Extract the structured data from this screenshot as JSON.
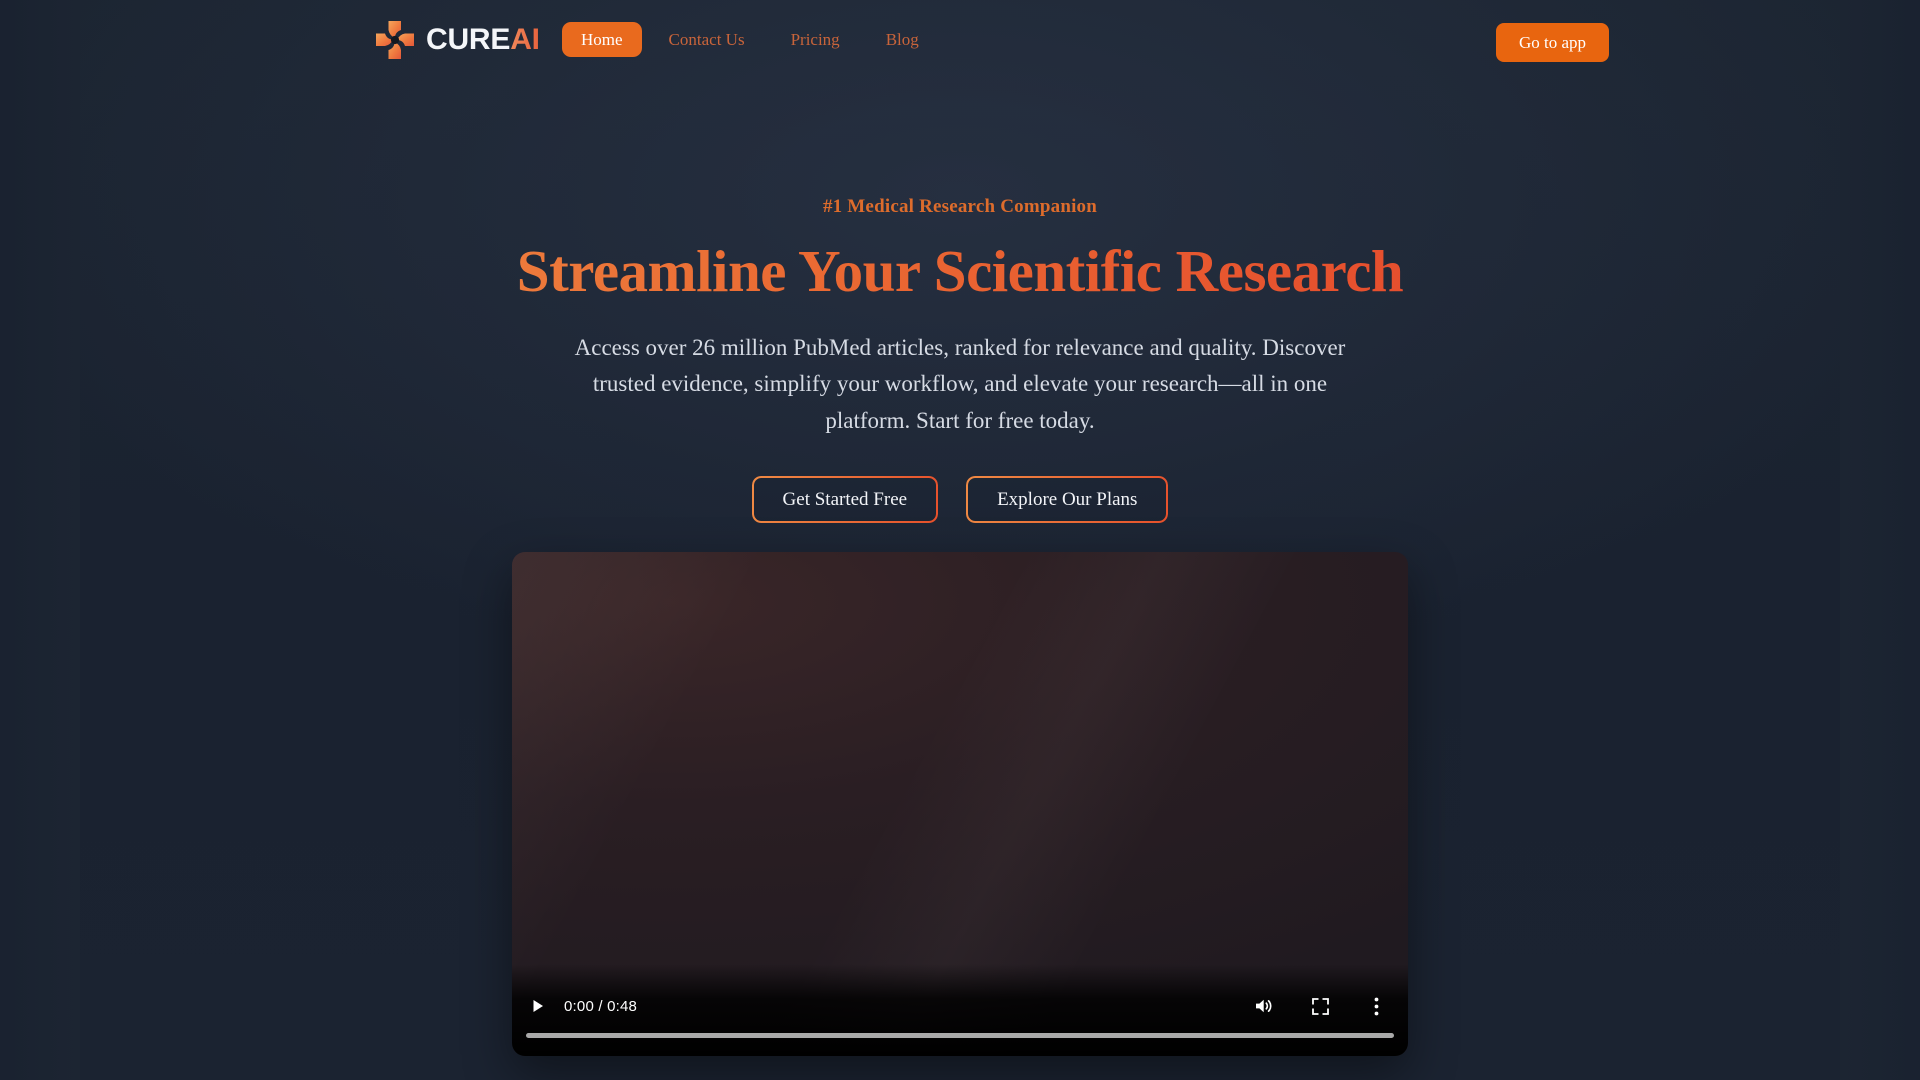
{
  "brand": {
    "logo_icon": "cure-ai-cross-pinwheel-logo",
    "name_primary": "CURE",
    "name_accent": "AI"
  },
  "nav": {
    "items": [
      {
        "label": "Home",
        "active": true
      },
      {
        "label": "Contact Us",
        "active": false
      },
      {
        "label": "Pricing",
        "active": false
      },
      {
        "label": "Blog",
        "active": false
      }
    ],
    "cta_label": "Go to app"
  },
  "hero": {
    "eyebrow": "#1 Medical Research Companion",
    "headline": "Streamline Your Scientific Research",
    "subcopy": "Access over 26 million PubMed articles, ranked for relevance and quality. Discover trusted evidence, simplify your workflow, and elevate your research—all in one platform. Start for free today.",
    "primary_cta": "Get Started Free",
    "secondary_cta": "Explore Our Plans"
  },
  "video": {
    "current_time": "0:00",
    "duration": "0:48",
    "time_display": "0:00 / 0:48",
    "progress_percent": 0,
    "play_icon": "play-icon",
    "volume_icon": "volume-icon",
    "fullscreen_icon": "fullscreen-icon",
    "more_icon": "kebab-menu-icon"
  },
  "colors": {
    "page_background": "#1b2330",
    "accent_orange": "#e8650f",
    "accent_orange_light": "#f0a04b",
    "accent_red": "#e33f30",
    "nav_link": "#c8643a",
    "body_text": "#d6dbe4"
  }
}
